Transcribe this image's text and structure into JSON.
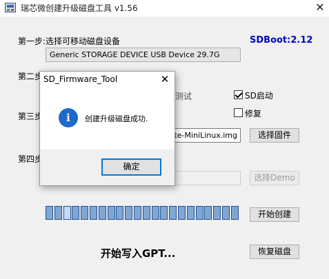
{
  "window": {
    "title": "瑞芯微创建升级磁盘工具 v1.56",
    "close_glyph": "✕"
  },
  "step1": {
    "label": "第一步:选择可移动磁盘设备",
    "device_selected": "Generic STORAGE DEVICE USB Device   29.7G"
  },
  "sdboot": "SDBoot:2.12",
  "step2": {
    "label_visible": "第二步",
    "partial_hidden": "测试"
  },
  "step3": {
    "label_visible": "第三步",
    "firmware_path_visible": "date-MiniLinux.img",
    "select_firmware_button": "选择固件"
  },
  "step4": {
    "label_visible": "第四步",
    "select_demo_button": "选择Demo"
  },
  "options": {
    "sd_boot_label": "SD启动",
    "sd_boot_checked": true,
    "repair_label": "修复",
    "repair_checked": false
  },
  "progress": {
    "total_segments": 22,
    "current_segment_index": 2
  },
  "buttons": {
    "start_create": "开始创建",
    "restore_disk": "恢复磁盘"
  },
  "status_text": "开始写入GPT...",
  "dialog": {
    "title": "SD_Firmware_Tool",
    "close_glyph": "✕",
    "icon": "info-icon",
    "icon_glyph": "i",
    "message": "创建升级磁盘成功.",
    "ok_button": "确定"
  },
  "colors": {
    "accent": "#1e69c9",
    "sdboot_text": "#0000cc",
    "progress_fill": "#7fa7d6",
    "focus_border": "#0078d7"
  }
}
